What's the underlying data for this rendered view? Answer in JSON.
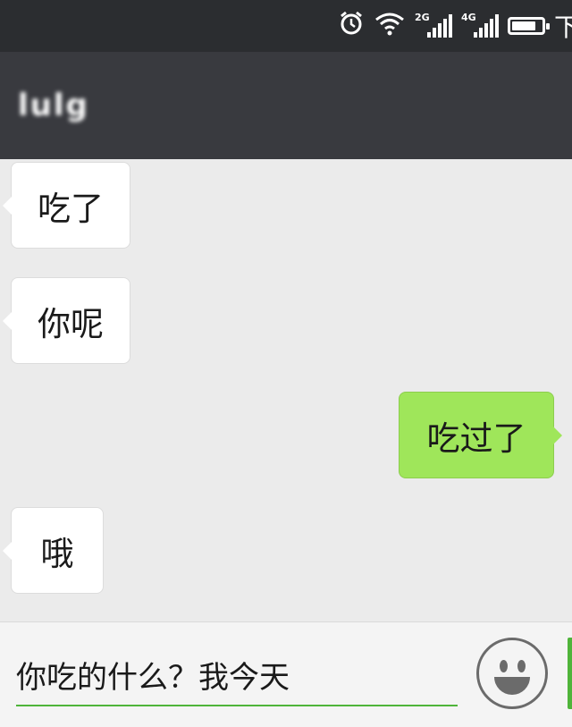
{
  "status_bar": {
    "alarm_icon": "alarm-clock-icon",
    "wifi_icon": "wifi-icon",
    "signal_1_label": "2G",
    "signal_2_label": "4G",
    "battery_level": 0.8,
    "time_fragment": "下"
  },
  "header": {
    "contact_name": "lulg"
  },
  "messages": [
    {
      "direction": "incoming",
      "text": "吃了"
    },
    {
      "direction": "incoming",
      "text": "你呢"
    },
    {
      "direction": "outgoing",
      "text": "吃过了"
    },
    {
      "direction": "incoming",
      "text": "哦"
    }
  ],
  "input_bar": {
    "value": "你吃的什么？我今天",
    "emoji_icon": "smiley-face-icon"
  },
  "colors": {
    "status_bar": "#2b2d30",
    "title_bar": "#393a3f",
    "chat_background": "#ebebeb",
    "incoming_bubble": "#ffffff",
    "outgoing_bubble": "#9fe65a",
    "accent_green": "#4fb43a"
  }
}
